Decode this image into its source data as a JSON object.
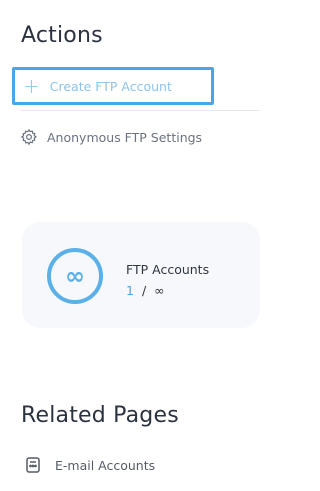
{
  "actions": {
    "title": "Actions",
    "create_label": "Create FTP Account",
    "anonymous_label": "Anonymous FTP Settings"
  },
  "stat": {
    "icon": "infinity-icon",
    "icon_glyph": "∞",
    "label": "FTP Accounts",
    "used": "1",
    "separator": "/",
    "limit": "∞"
  },
  "related": {
    "title": "Related Pages",
    "items": [
      {
        "label": "E-mail Accounts",
        "icon": "email-accounts-icon"
      }
    ]
  },
  "colors": {
    "accent": "#4aa6e6",
    "text": "#2b3340",
    "muted": "#6b7380",
    "card_bg": "#f6f8fb"
  }
}
